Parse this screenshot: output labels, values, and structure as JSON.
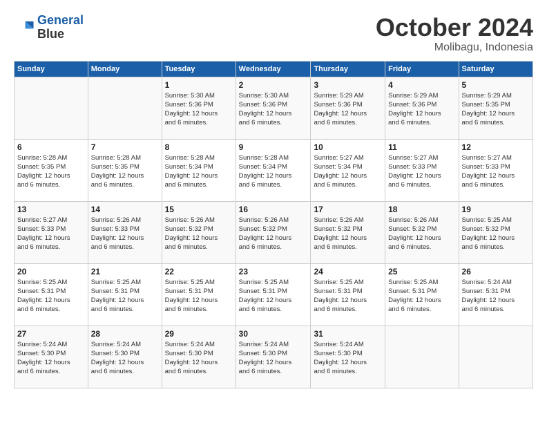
{
  "logo": {
    "line1": "General",
    "line2": "Blue"
  },
  "title": "October 2024",
  "location": "Molibagu, Indonesia",
  "days_header": [
    "Sunday",
    "Monday",
    "Tuesday",
    "Wednesday",
    "Thursday",
    "Friday",
    "Saturday"
  ],
  "weeks": [
    [
      {
        "day": "",
        "info": ""
      },
      {
        "day": "",
        "info": ""
      },
      {
        "day": "1",
        "info": "Sunrise: 5:30 AM\nSunset: 5:36 PM\nDaylight: 12 hours\nand 6 minutes."
      },
      {
        "day": "2",
        "info": "Sunrise: 5:30 AM\nSunset: 5:36 PM\nDaylight: 12 hours\nand 6 minutes."
      },
      {
        "day": "3",
        "info": "Sunrise: 5:29 AM\nSunset: 5:36 PM\nDaylight: 12 hours\nand 6 minutes."
      },
      {
        "day": "4",
        "info": "Sunrise: 5:29 AM\nSunset: 5:36 PM\nDaylight: 12 hours\nand 6 minutes."
      },
      {
        "day": "5",
        "info": "Sunrise: 5:29 AM\nSunset: 5:35 PM\nDaylight: 12 hours\nand 6 minutes."
      }
    ],
    [
      {
        "day": "6",
        "info": "Sunrise: 5:28 AM\nSunset: 5:35 PM\nDaylight: 12 hours\nand 6 minutes."
      },
      {
        "day": "7",
        "info": "Sunrise: 5:28 AM\nSunset: 5:35 PM\nDaylight: 12 hours\nand 6 minutes."
      },
      {
        "day": "8",
        "info": "Sunrise: 5:28 AM\nSunset: 5:34 PM\nDaylight: 12 hours\nand 6 minutes."
      },
      {
        "day": "9",
        "info": "Sunrise: 5:28 AM\nSunset: 5:34 PM\nDaylight: 12 hours\nand 6 minutes."
      },
      {
        "day": "10",
        "info": "Sunrise: 5:27 AM\nSunset: 5:34 PM\nDaylight: 12 hours\nand 6 minutes."
      },
      {
        "day": "11",
        "info": "Sunrise: 5:27 AM\nSunset: 5:33 PM\nDaylight: 12 hours\nand 6 minutes."
      },
      {
        "day": "12",
        "info": "Sunrise: 5:27 AM\nSunset: 5:33 PM\nDaylight: 12 hours\nand 6 minutes."
      }
    ],
    [
      {
        "day": "13",
        "info": "Sunrise: 5:27 AM\nSunset: 5:33 PM\nDaylight: 12 hours\nand 6 minutes."
      },
      {
        "day": "14",
        "info": "Sunrise: 5:26 AM\nSunset: 5:33 PM\nDaylight: 12 hours\nand 6 minutes."
      },
      {
        "day": "15",
        "info": "Sunrise: 5:26 AM\nSunset: 5:32 PM\nDaylight: 12 hours\nand 6 minutes."
      },
      {
        "day": "16",
        "info": "Sunrise: 5:26 AM\nSunset: 5:32 PM\nDaylight: 12 hours\nand 6 minutes."
      },
      {
        "day": "17",
        "info": "Sunrise: 5:26 AM\nSunset: 5:32 PM\nDaylight: 12 hours\nand 6 minutes."
      },
      {
        "day": "18",
        "info": "Sunrise: 5:26 AM\nSunset: 5:32 PM\nDaylight: 12 hours\nand 6 minutes."
      },
      {
        "day": "19",
        "info": "Sunrise: 5:25 AM\nSunset: 5:32 PM\nDaylight: 12 hours\nand 6 minutes."
      }
    ],
    [
      {
        "day": "20",
        "info": "Sunrise: 5:25 AM\nSunset: 5:31 PM\nDaylight: 12 hours\nand 6 minutes."
      },
      {
        "day": "21",
        "info": "Sunrise: 5:25 AM\nSunset: 5:31 PM\nDaylight: 12 hours\nand 6 minutes."
      },
      {
        "day": "22",
        "info": "Sunrise: 5:25 AM\nSunset: 5:31 PM\nDaylight: 12 hours\nand 6 minutes."
      },
      {
        "day": "23",
        "info": "Sunrise: 5:25 AM\nSunset: 5:31 PM\nDaylight: 12 hours\nand 6 minutes."
      },
      {
        "day": "24",
        "info": "Sunrise: 5:25 AM\nSunset: 5:31 PM\nDaylight: 12 hours\nand 6 minutes."
      },
      {
        "day": "25",
        "info": "Sunrise: 5:25 AM\nSunset: 5:31 PM\nDaylight: 12 hours\nand 6 minutes."
      },
      {
        "day": "26",
        "info": "Sunrise: 5:24 AM\nSunset: 5:31 PM\nDaylight: 12 hours\nand 6 minutes."
      }
    ],
    [
      {
        "day": "27",
        "info": "Sunrise: 5:24 AM\nSunset: 5:30 PM\nDaylight: 12 hours\nand 6 minutes."
      },
      {
        "day": "28",
        "info": "Sunrise: 5:24 AM\nSunset: 5:30 PM\nDaylight: 12 hours\nand 6 minutes."
      },
      {
        "day": "29",
        "info": "Sunrise: 5:24 AM\nSunset: 5:30 PM\nDaylight: 12 hours\nand 6 minutes."
      },
      {
        "day": "30",
        "info": "Sunrise: 5:24 AM\nSunset: 5:30 PM\nDaylight: 12 hours\nand 6 minutes."
      },
      {
        "day": "31",
        "info": "Sunrise: 5:24 AM\nSunset: 5:30 PM\nDaylight: 12 hours\nand 6 minutes."
      },
      {
        "day": "",
        "info": ""
      },
      {
        "day": "",
        "info": ""
      }
    ]
  ]
}
